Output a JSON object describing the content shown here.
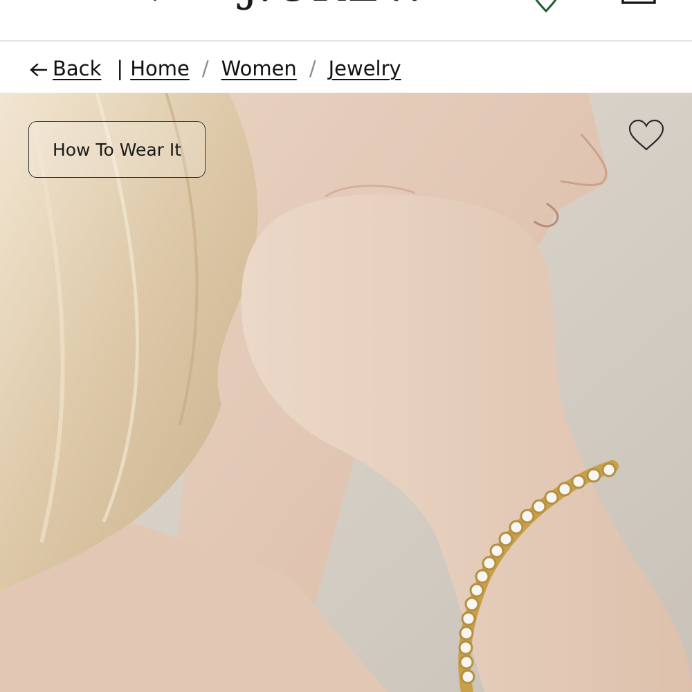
{
  "header": {
    "logo_text": "J.CREW",
    "icons": {
      "menu": "menu-icon",
      "favorites": "heart-icon",
      "bag": "shopping-bag-icon"
    },
    "accent_color": "#1d5c2e"
  },
  "breadcrumb": {
    "back_label": "Back",
    "items": [
      {
        "label": "Home"
      },
      {
        "label": "Women"
      },
      {
        "label": "Jewelry"
      }
    ],
    "separator": "/"
  },
  "hero": {
    "wear_button_label": "How To Wear It",
    "favorite_icon": "heart-outline-icon"
  }
}
